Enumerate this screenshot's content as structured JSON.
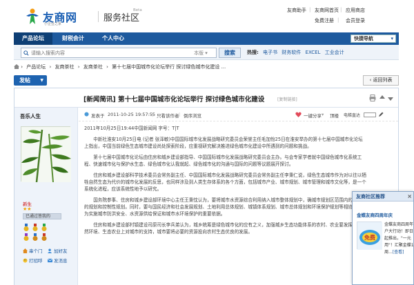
{
  "header": {
    "logo_name": "友商网",
    "logo_sub": "小企业之家",
    "site_title": "服务社区",
    "beta": "Beta",
    "links": {
      "help": "友商助手",
      "home": "友商网首页",
      "app_store": "应用商店",
      "register": "免费注册",
      "login": "会员登录"
    }
  },
  "nav": {
    "tabs": [
      "产品论坛",
      "财税会计",
      "个人中心"
    ],
    "active_tab": "产品论坛",
    "quick_nav": "快捷导航"
  },
  "search": {
    "placeholder": "请输入搜索内容",
    "scope": "本版",
    "button": "搜索",
    "hot_label": "热搜:",
    "hot_links": [
      "电子书",
      "财务软件",
      "EXCEL",
      "工业会计"
    ]
  },
  "breadcrumb": [
    "产品论坛",
    "友商茶社",
    "友商茶社",
    "第十七届中国城市化论坛举行 探讨绿色城市化建设 ..."
  ],
  "actions": {
    "post": "发帖",
    "back": "返回列表"
  },
  "thread": {
    "title": "[新闻简讯] 第十七届中国城市化论坛举行 探讨绿色城市化建设",
    "copy_link": "[复制链接]"
  },
  "author": {
    "name": "吾乐人生",
    "rank": "新生",
    "stars": "★★",
    "level": "已通过答我的",
    "actions": {
      "visit": "串个门",
      "add_friend": "加好友",
      "greet": "打招呼",
      "message": "发消息"
    }
  },
  "meta": {
    "posted_prefix": "发表于",
    "posted_time": "2011-10-25 19:57:55",
    "author_only": "只看该作者",
    "reverse": "倒序浏览",
    "share": "一键分享",
    "top": "顶楼",
    "reader": "电梯直达"
  },
  "post": {
    "dateline": "2011年10月25日19:44中国新闻网 字号：T|T",
    "paragraphs": [
      "中新社淮安10月25日电 (记者 张泽敏)中国国际城市化发展战略研究委员会荣誉主任毛加怡25日在淮安举办的第十七届中国城市化论坛上指出，中国当前绿色生态城市建设尚处探索阶段，应重视研究解决推进绿色城市化建设中所遇到的问题和挑战。",
      "第十七届中国城市化论坛由住房和城乡建设部指导、中国国际城市化发展战略研究委员会主办。与会专家学者就中国绿色城市化系统工程、快速城市化与保护水生态、绿色城市化认我就起、绿色城市化的沟通与国际的问题等议题展开探讨。",
      "住房和城乡建设部科学技术委员会常务副主任、中国国际城市化发展战略研究委员会常务副主任李秉仁说，绿色生态城市作为对以往以牺牲自然生态为代价的城市化发展的反思，也同样涉及到人类生存体系的各个方面，包括城市产业、城市规划、城市管理和城市文化等，是一个系统化进程，应该系统性地予以研究。",
      "国务院参事、住房和城乡建设部环境中心主任王秉忱认为，要将城市水资源综合利用纳入城市整体规划中，确城市规划区范围内的水工程的规划和控制性规划。同时，要与国民经济和社会发展规划、土地利用总体规划、城镇体系规划、城市总体规划和环境保护规划等相协调，作为实施城市防洪安全、水资源供给保证和城市水环境保护的重要依据。",
      "住房和城乡建设部村镇建设司原司长李兵弟认为，城乡统筹是绿色城市化的应有之义，加强城乡生态功能体系的农村、农业要发挥其在自然环境、生态农业上对城市的支持，城市要将必要的资源投向农村生态优良的发展。"
    ]
  },
  "popup": {
    "title": "友商社区推荐",
    "close": "×",
    "headline": "金蝶友商四周年庆",
    "img_label": "免费",
    "lines": [
      "金蝶友商四周年",
      "户大行动！即日",
      "起推出，\"一元",
      "用\"！汇聚金蝶18",
      "周..."
    ],
    "more": "[查看]"
  }
}
